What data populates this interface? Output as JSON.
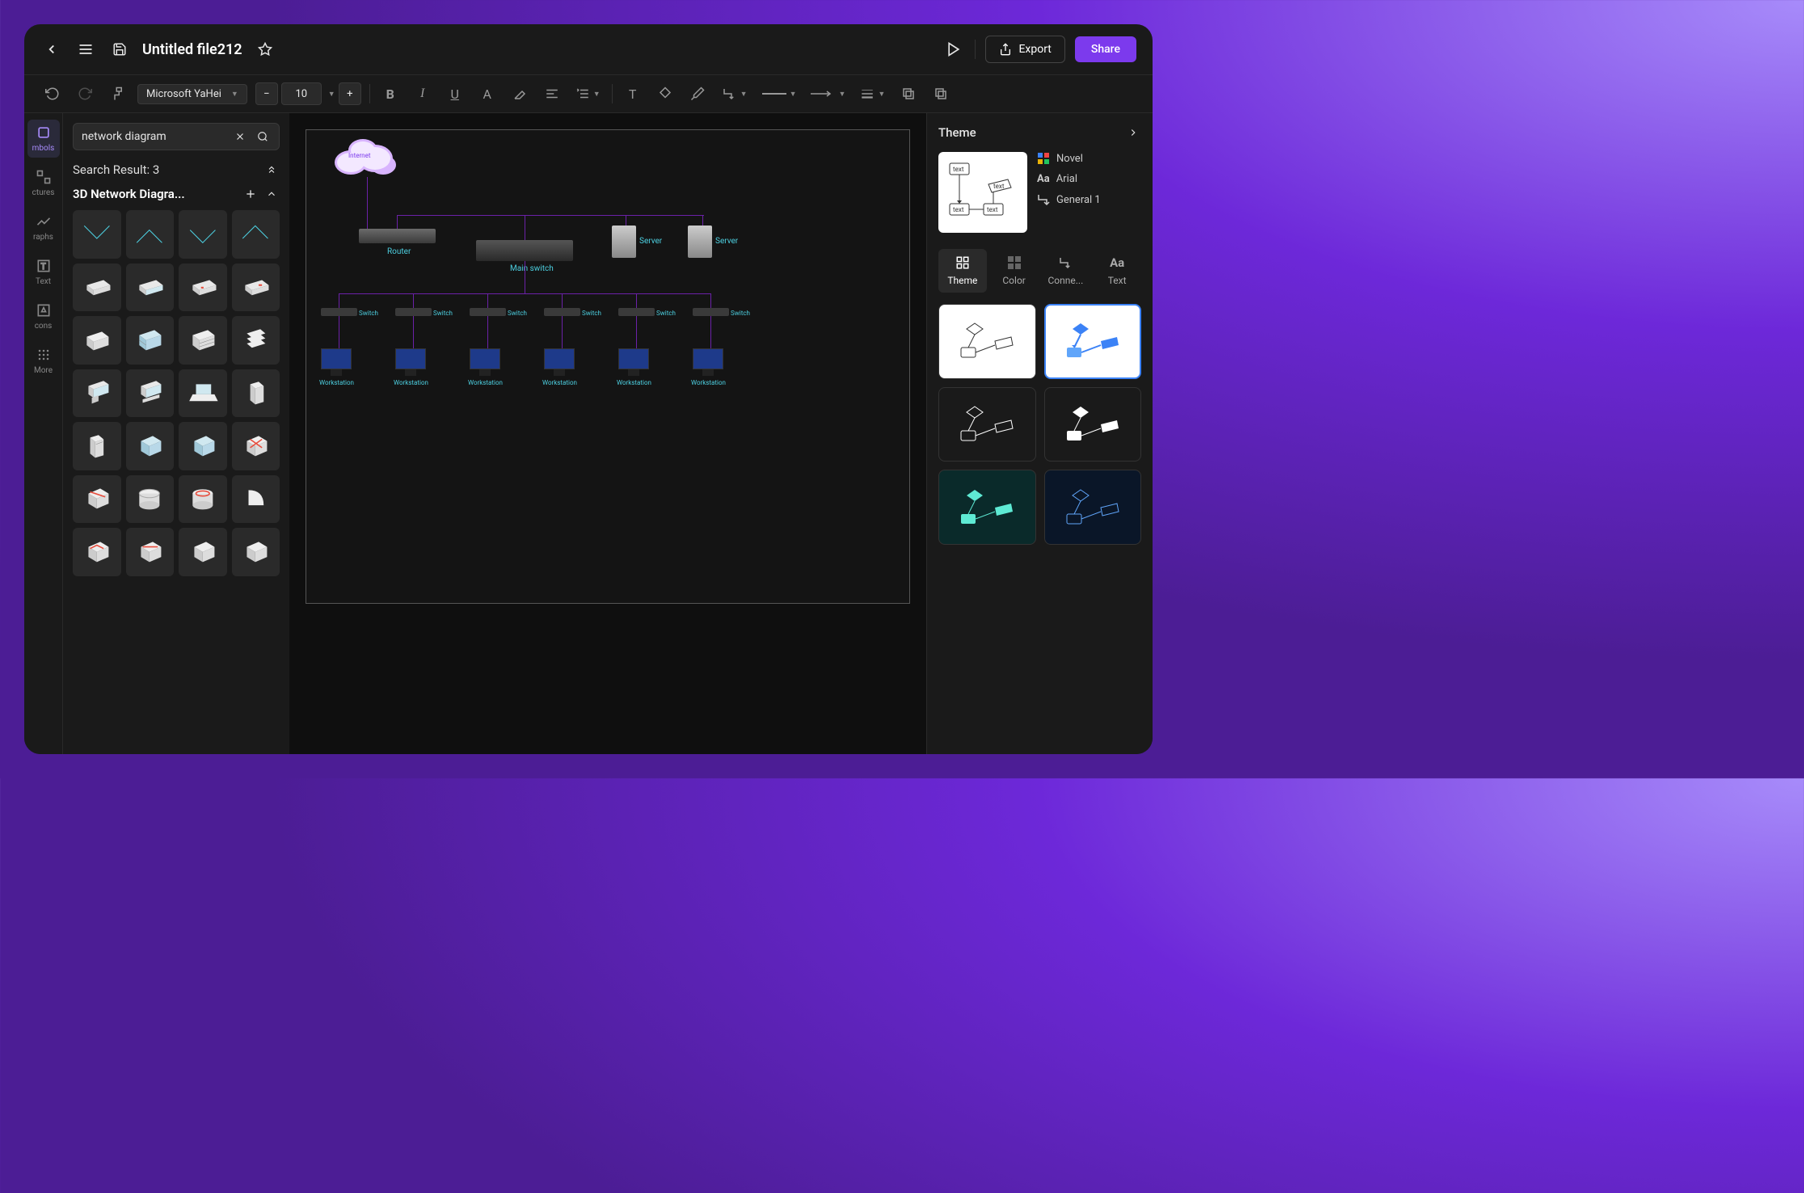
{
  "header": {
    "file_title": "Untitled file212",
    "export": "Export",
    "share": "Share"
  },
  "toolbar": {
    "font_family": "Microsoft YaHei",
    "font_size": "10"
  },
  "leftTabs": {
    "symbols": "mbols",
    "structures": "ctures",
    "graphs": "raphs",
    "text": "Text",
    "icons": "cons",
    "more": "More"
  },
  "symbols": {
    "search_value": "network diagram",
    "search_result": "Search Result: 3",
    "library_name": "3D Network Diagra..."
  },
  "diagram": {
    "internet": "Internet",
    "router": "Router",
    "main_switch": "Main switch",
    "server1": "Server",
    "server2": "Server",
    "switch": "Switch",
    "workstation": "Workstation"
  },
  "rightPanel": {
    "title": "Theme",
    "text_box": "text",
    "scheme": "Novel",
    "font": "Arial",
    "connector": "General 1",
    "tabs": {
      "theme": "Theme",
      "color": "Color",
      "connector": "Conne...",
      "text": "Text"
    }
  }
}
